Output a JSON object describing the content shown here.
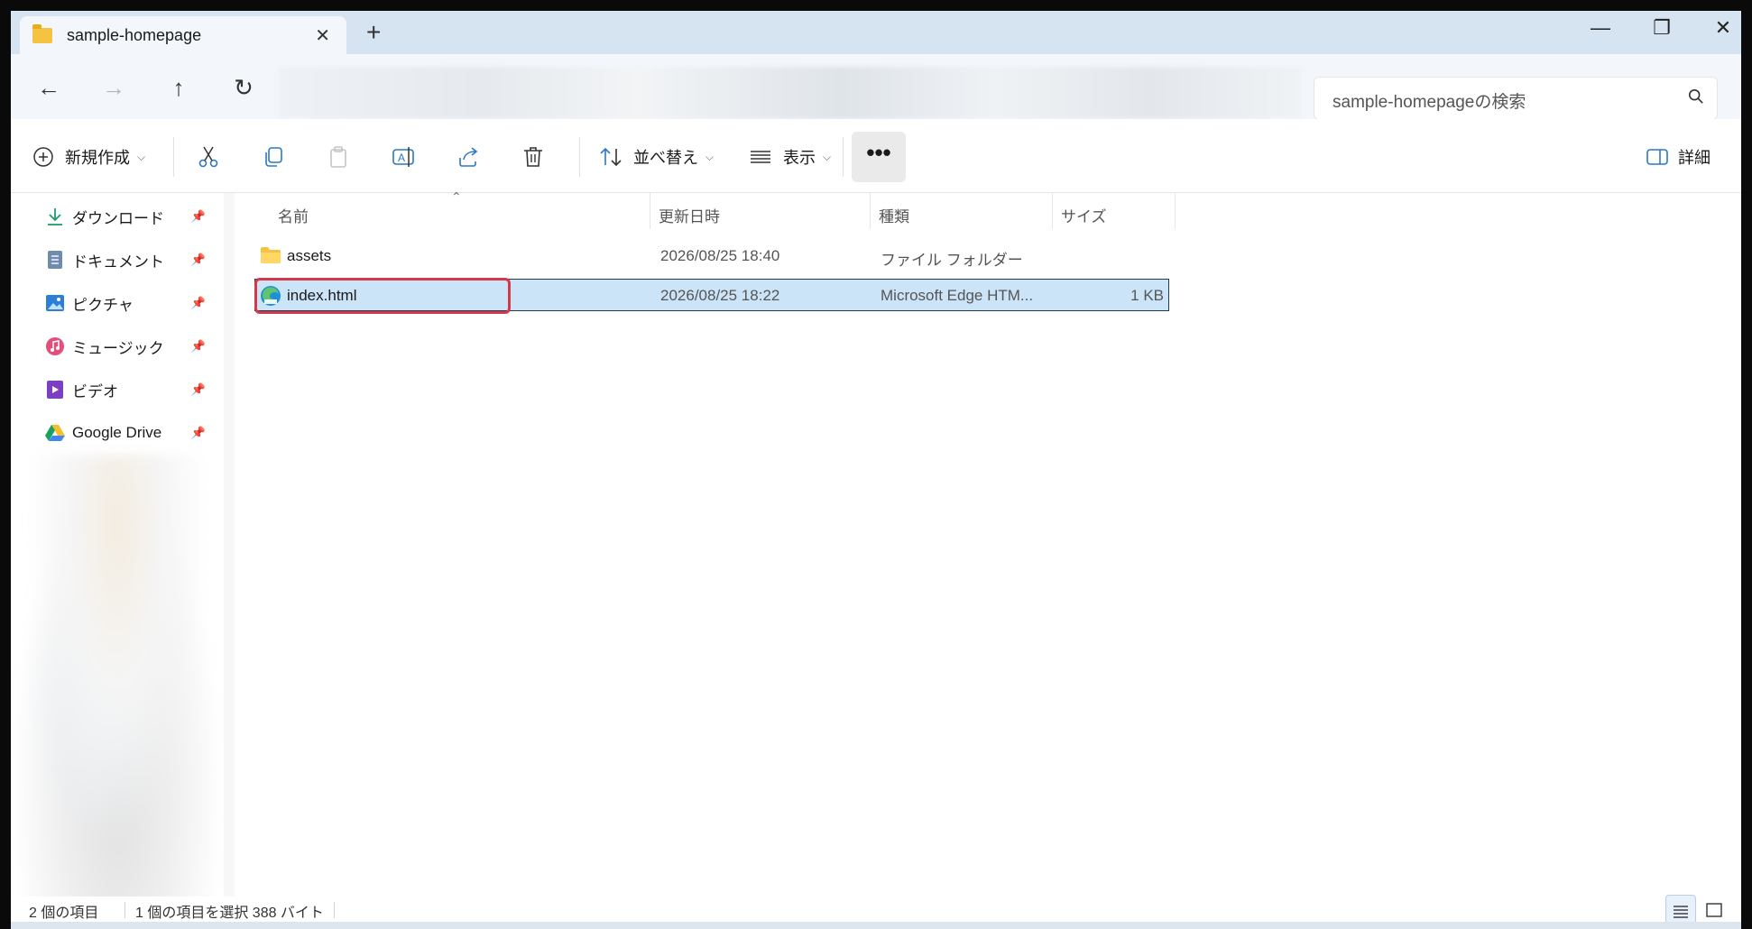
{
  "window": {
    "tab_title": "sample-homepage",
    "new_tab": "+",
    "minimize": "—",
    "restore": "❐",
    "close": "✕"
  },
  "nav": {
    "back": "←",
    "forward": "→",
    "up": "↑",
    "refresh": "↻"
  },
  "search": {
    "placeholder": "sample-homepageの検索"
  },
  "toolbar": {
    "new_label": "新規作成",
    "sort_label": "並べ替え",
    "view_label": "表示",
    "more_label": "•••",
    "details_label": "詳細"
  },
  "sidebar": {
    "items": [
      {
        "label": "ダウンロード",
        "icon": "download-icon"
      },
      {
        "label": "ドキュメント",
        "icon": "document-icon"
      },
      {
        "label": "ピクチャ",
        "icon": "picture-icon"
      },
      {
        "label": "ミュージック",
        "icon": "music-icon"
      },
      {
        "label": "ビデオ",
        "icon": "video-icon"
      },
      {
        "label": "Google Drive",
        "icon": "google-drive-icon"
      }
    ]
  },
  "columns": {
    "name": "名前",
    "modified": "更新日時",
    "type": "種類",
    "size": "サイズ"
  },
  "files": [
    {
      "name": "assets",
      "modified": "2026/08/25 18:40",
      "type": "ファイル フォルダー",
      "size": "",
      "icon": "folder-icon"
    },
    {
      "name": "index.html",
      "modified": "2026/08/25 18:22",
      "type": "Microsoft Edge HTM...",
      "size": "1 KB",
      "icon": "edge-html-icon"
    }
  ],
  "status": {
    "item_count": "2 個の項目",
    "selection": "1 個の項目を選択  388 バイト"
  },
  "colors": {
    "accent": "#0067c0",
    "selection": "#cce4f7",
    "highlight": "#d23a4a",
    "titlebar": "#d6e3f0"
  }
}
